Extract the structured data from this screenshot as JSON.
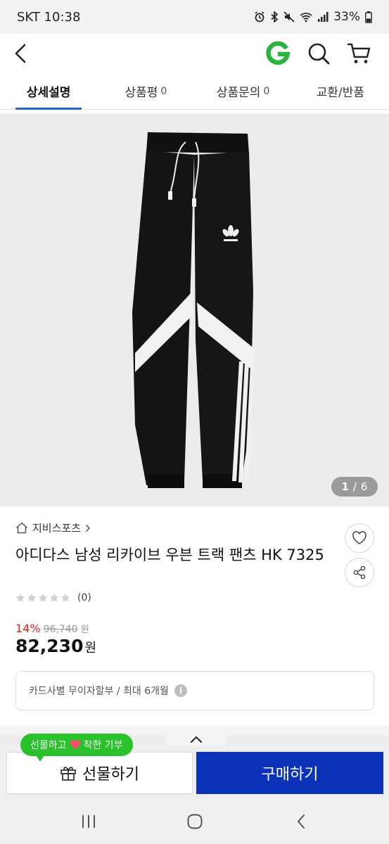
{
  "status_bar": {
    "carrier_time": "SKT 10:38",
    "battery": "33%"
  },
  "header": {
    "back_icon": "chevron-left-icon",
    "logo_icon": "gmarket-g-logo",
    "search_icon": "search-icon",
    "cart_icon": "cart-icon"
  },
  "tabs": [
    {
      "label": "상세설명",
      "count": ""
    },
    {
      "label": "상품평",
      "count": "0"
    },
    {
      "label": "상품문의",
      "count": "0"
    },
    {
      "label": "교환/반품",
      "count": ""
    }
  ],
  "gallery": {
    "current": "1",
    "sep": "/",
    "total": "6"
  },
  "product": {
    "brand": "지비스포츠",
    "title": "아디다스 남성 리카이브 우븐 트랙 팬츠 HK 7325",
    "rating_count": "(0)",
    "discount": "14%",
    "original_price": "96,740",
    "won_small": "원",
    "final_price": "82,230",
    "won": "원",
    "installment": "카드사별 무이자할부 / 최대 6개월"
  },
  "bottom": {
    "gift_tip": "선물하고",
    "gift_tip_2": "착한 기부",
    "gift_label": "선물하기",
    "buy_label": "구매하기"
  },
  "colors": {
    "accent": "#2566c9",
    "buy": "#0b32b8",
    "discount": "#e0231b",
    "gift_tip": "#29c22b",
    "logo": "#2bb23f"
  }
}
